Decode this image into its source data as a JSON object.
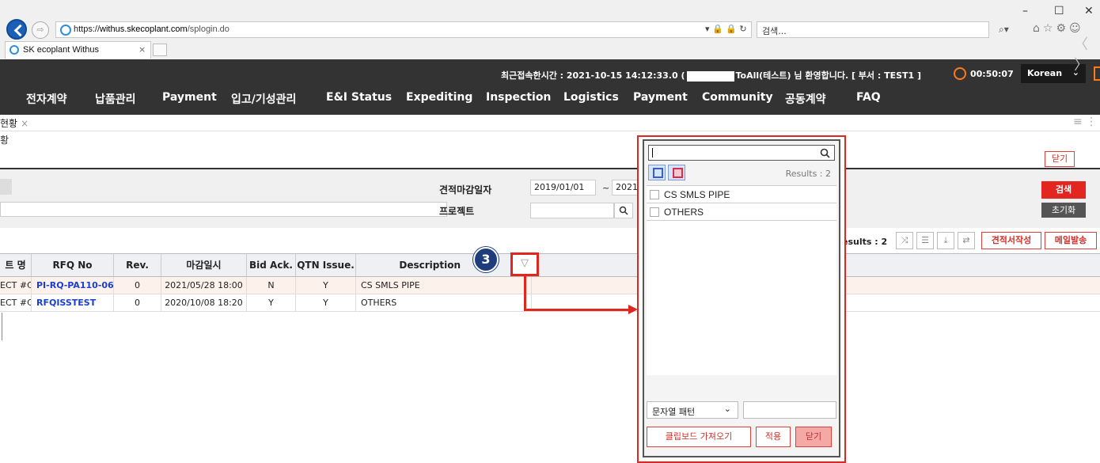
{
  "browser": {
    "url_scheme": "https://",
    "url_host": "withus.skecoplant.com",
    "url_path": "/splogin.do",
    "search_placeholder": "검색...",
    "tab_title": "SK ecoplant Withus",
    "tab_close": "×",
    "window_controls": [
      "–",
      "☐",
      "✕"
    ],
    "address_tools": "▾ 🔒 🔒 ↻",
    "search_tools": "⌕▾",
    "right_icons": "⌂☆⚙☺"
  },
  "header": {
    "last_access": "최근접속한시간 : 2021-10-15 14:12:33.0  (",
    "welcome": "ToAll(테스트) 님 환영합니다. [ 부서 : TEST1 ]",
    "timer": "00:50:07",
    "language": "Korean",
    "language_chevron": "⌄",
    "nav_arrows": "〈 〉 ",
    "nav": [
      "전자계약",
      "납품관리",
      "Payment",
      "입고/기성관리",
      "E&I Status",
      "Expediting",
      "Inspection",
      "Logistics",
      "Payment",
      "Community",
      "공동계약",
      "FAQ"
    ]
  },
  "content_tabs": {
    "active_tab": "현황",
    "close": "×",
    "breadcrumb": "황",
    "menu_icon": "≡  ⋮"
  },
  "buttons": {
    "close_top": "닫기",
    "search": "검색",
    "reset": "초기화",
    "quote_write": "견적서작성",
    "mail_send": "메일발송"
  },
  "search": {
    "deadline_label": "견적마감일자",
    "date_from": "2019/01/01",
    "tilde": "~",
    "date_to": "2021/",
    "project_label": "프로젝트",
    "search_icon": "🔍"
  },
  "grid": {
    "results": "esults : 2",
    "toolbar_icons": [
      "⤨",
      "☰",
      "⤓",
      "⇄"
    ],
    "columns": [
      "트 명",
      "RFQ No",
      "Rev.",
      "마감일시",
      "Bid Ack.",
      "QTN Issue.",
      "Description"
    ],
    "rows": [
      [
        "ECT #C",
        "PI-RQ-PA110-06",
        "0",
        "2021/05/28 18:00",
        "N",
        "Y",
        "CS SMLS PIPE"
      ],
      [
        "ECT #C",
        "RFQISSTEST",
        "0",
        "2020/10/08 18:20",
        "Y",
        "Y",
        "OTHERS"
      ]
    ],
    "step_badge": "3",
    "filter_icon": "▽"
  },
  "filter_popup": {
    "search_icon": "🔍",
    "results": "Results : 2",
    "items": [
      "CS SMLS PIPE",
      "OTHERS"
    ],
    "pattern_label": "문자열 패턴",
    "pattern_chevron": "⌄",
    "clipboard_btn": "클립보드 가져오기",
    "apply_btn": "적용",
    "close_btn": "닫기"
  },
  "colors": {
    "accent_red": "#e0261f",
    "header_dark": "#333333",
    "link_blue": "#1a3fd0",
    "badge_navy": "#1f3d7a"
  }
}
